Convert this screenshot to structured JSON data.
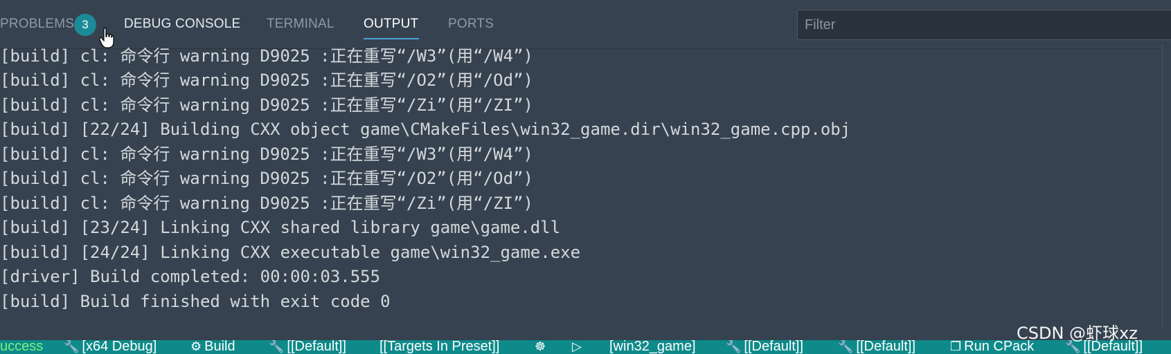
{
  "tabs": {
    "problems": "PROBLEMS",
    "problems_count": "3",
    "debug_console": "DEBUG CONSOLE",
    "terminal": "TERMINAL",
    "output": "OUTPUT",
    "ports": "PORTS"
  },
  "filter": {
    "placeholder": "Filter",
    "value": ""
  },
  "output_lines": [
    "[build] cl: 命令行 warning D9025 :正在重写“/W3”(用“/W4”)",
    "[build] cl: 命令行 warning D9025 :正在重写“/O2”(用“/Od”)",
    "[build] cl: 命令行 warning D9025 :正在重写“/Zi”(用“/ZI”)",
    "[build] [22/24] Building CXX object game\\CMakeFiles\\win32_game.dir\\win32_game.cpp.obj",
    "[build] cl: 命令行 warning D9025 :正在重写“/W3”(用“/W4”)",
    "[build] cl: 命令行 warning D9025 :正在重写“/O2”(用“/Od”)",
    "[build] cl: 命令行 warning D9025 :正在重写“/Zi”(用“/ZI”)",
    "[build] [23/24] Linking CXX shared library game\\game.dll",
    "[build] [24/24] Linking CXX executable game\\win32_game.exe",
    "[driver] Build completed: 00:00:03.555",
    "[build] Build finished with exit code 0"
  ],
  "statusbar": {
    "success": "uccess",
    "preset": "[x64 Debug]",
    "build": "Build",
    "default1": "[[Default]]",
    "targets": "[[Targets In Preset]]",
    "target": "[win32_game]",
    "default2": "[[Default]]",
    "default3": "[[Default]]",
    "run_cpack": "Run CPack",
    "default4": "[[Default]]"
  },
  "icons": {
    "wrench": "wrench-icon",
    "gear": "gear-icon",
    "bug": "bug-icon",
    "play": "play-icon",
    "package": "package-icon",
    "cursor": "hand-pointer-icon"
  },
  "colors": {
    "panel_bg": "#36424f",
    "statusbar_bg": "#0e8a8a",
    "badge_bg": "#1d8a99",
    "active_underline": "#4ea3d8",
    "success_text": "#7cf07c"
  },
  "watermark": "CSDN @虾球xz"
}
